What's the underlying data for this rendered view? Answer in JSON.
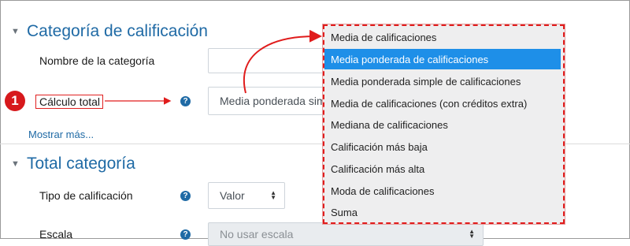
{
  "sections": [
    {
      "title": "Categoría de calificación"
    },
    {
      "title": "Total categoría"
    }
  ],
  "fields": {
    "category_name": {
      "label": "Nombre de la categoría",
      "value": ""
    },
    "total_calc": {
      "label": "Cálculo total",
      "value": "Media ponderada sim"
    },
    "grade_type": {
      "label": "Tipo de calificación",
      "value": "Valor"
    },
    "scale": {
      "label": "Escala",
      "value": "No usar escala"
    }
  },
  "show_more": "Mostrar más...",
  "marker": {
    "number": "1"
  },
  "help_symbol": "?",
  "dropdown": {
    "selected_index": 1,
    "options": [
      "Media de calificaciones",
      "Media ponderada de calificaciones",
      "Media ponderada simple de calificaciones",
      "Media de calificaciones (con créditos extra)",
      "Mediana de calificaciones",
      "Calificación más baja",
      "Calificación más alta",
      "Moda de calificaciones",
      "Suma"
    ]
  },
  "colors": {
    "accent": "#1f6aa5",
    "selected_option": "#1e8fe8",
    "annotation_red": "#e01c1c"
  },
  "icons": {
    "caret": "▼",
    "select_arrows": "▲▼"
  }
}
